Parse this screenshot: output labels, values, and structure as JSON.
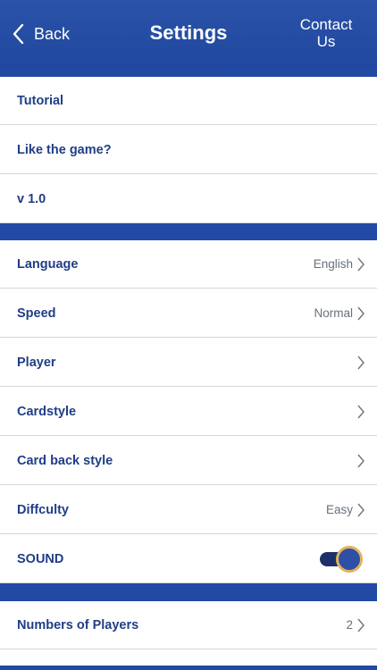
{
  "header": {
    "back_label": "Back",
    "title": "Settings",
    "contact_label_line1": "Contact",
    "contact_label_line2": "Us"
  },
  "section1": {
    "items": [
      {
        "label": "Tutorial"
      },
      {
        "label": "Like the game?"
      },
      {
        "label": "v 1.0"
      }
    ]
  },
  "section2": {
    "items": [
      {
        "label": "Language",
        "value": "English"
      },
      {
        "label": "Speed",
        "value": "Normal"
      },
      {
        "label": "Player",
        "value": ""
      },
      {
        "label": "Cardstyle",
        "value": ""
      },
      {
        "label": "Card back style",
        "value": ""
      },
      {
        "label": "Diffculty",
        "value": "Easy"
      }
    ],
    "sound": {
      "label": "SOUND",
      "enabled": true
    }
  },
  "section3": {
    "items": [
      {
        "label": "Numbers of Players",
        "value": "2"
      }
    ]
  },
  "colors": {
    "brand_blue": "#2249a4",
    "label_text": "#203e86",
    "value_text": "#676f7c",
    "toggle_knob_ring": "#e1b35d"
  }
}
